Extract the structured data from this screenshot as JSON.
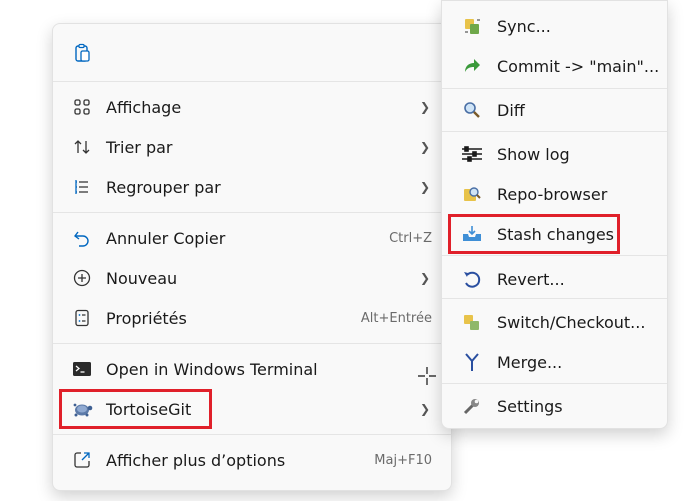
{
  "main_menu": {
    "items": [
      {
        "label": "Affichage",
        "icon": "grid-icon",
        "submenu": true
      },
      {
        "label": "Trier par",
        "icon": "sort-icon",
        "submenu": true
      },
      {
        "label": "Regrouper par",
        "icon": "group-icon",
        "submenu": true
      },
      {
        "label": "Annuler Copier",
        "icon": "undo-icon",
        "shortcut": "Ctrl+Z"
      },
      {
        "label": "Nouveau",
        "icon": "new-icon",
        "submenu": true
      },
      {
        "label": "Propriétés",
        "icon": "properties-icon",
        "shortcut": "Alt+Entrée"
      },
      {
        "label": "Open in Windows Terminal",
        "icon": "terminal-icon"
      },
      {
        "label": "TortoiseGit",
        "icon": "tortoisegit-icon",
        "submenu": true
      },
      {
        "label": "Afficher plus d’options",
        "icon": "more-options-icon",
        "shortcut": "Maj+F10"
      }
    ]
  },
  "sub_menu": {
    "items": [
      {
        "label": "Sync...",
        "icon": "sync-icon"
      },
      {
        "label": "Commit -> \"main\"...",
        "icon": "commit-icon"
      },
      {
        "label": "Diff",
        "icon": "diff-icon"
      },
      {
        "label": "Show log",
        "icon": "log-icon"
      },
      {
        "label": "Repo-browser",
        "icon": "repo-browser-icon"
      },
      {
        "label": "Stash changes",
        "icon": "stash-icon"
      },
      {
        "label": "Revert...",
        "icon": "revert-icon"
      },
      {
        "label": "Switch/Checkout...",
        "icon": "switch-icon"
      },
      {
        "label": "Merge...",
        "icon": "merge-icon"
      },
      {
        "label": "Settings",
        "icon": "settings-icon"
      }
    ]
  },
  "colors": {
    "highlight": "#e0202a",
    "accent": "#0067c0"
  }
}
